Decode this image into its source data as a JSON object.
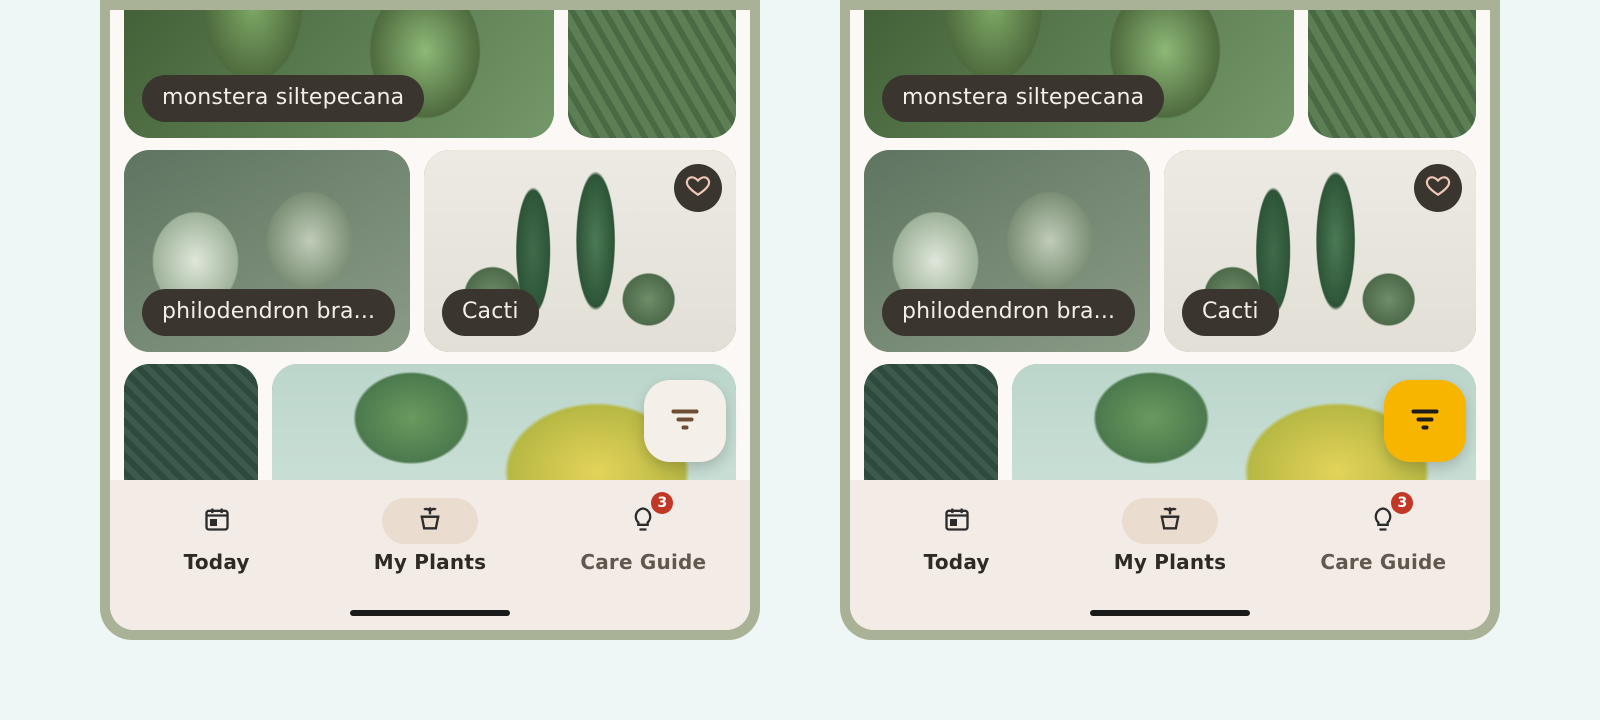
{
  "cards": {
    "monstera": {
      "label": "monstera siltepecana"
    },
    "philodendron": {
      "label": "philodendron bra..."
    },
    "cacti": {
      "label": "Cacti"
    }
  },
  "nav": {
    "today": {
      "label": "Today"
    },
    "my_plants": {
      "label": "My Plants"
    },
    "care_guide": {
      "label": "Care Guide",
      "badge": "3"
    }
  },
  "screens": {
    "left": {
      "filter_variant": "light"
    },
    "right": {
      "filter_variant": "yellow"
    }
  }
}
